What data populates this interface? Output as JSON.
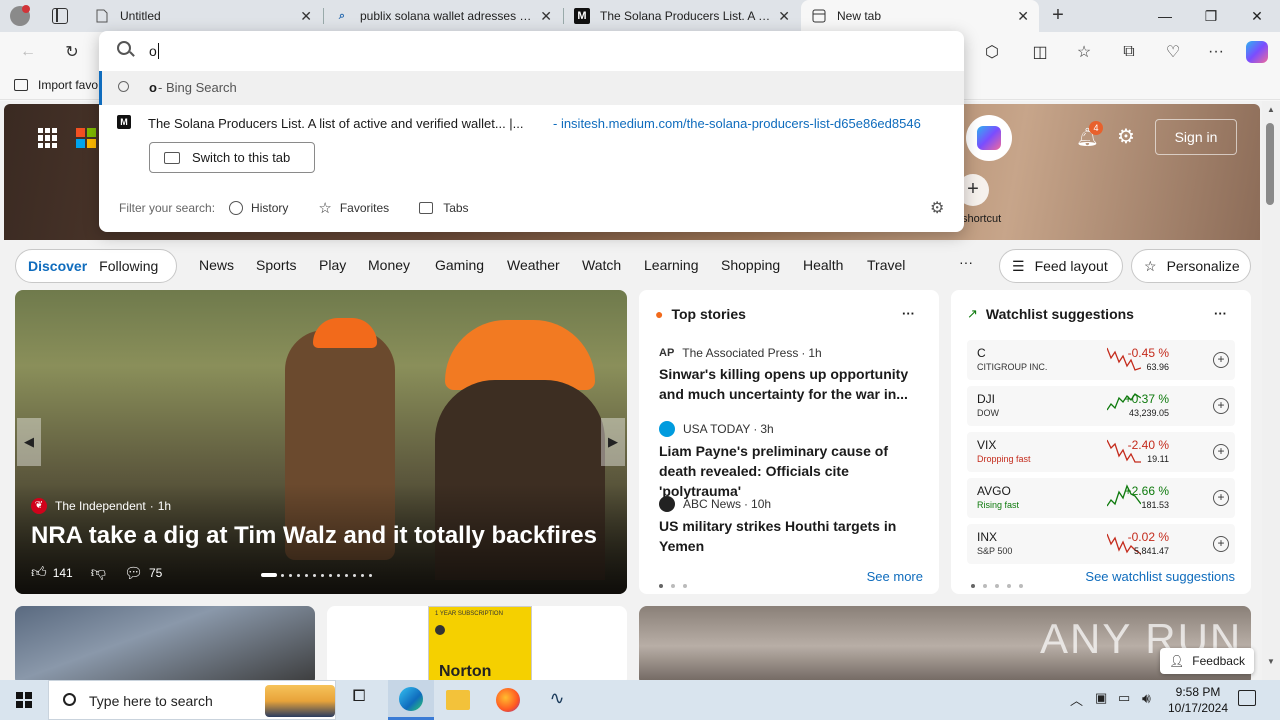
{
  "tabs": [
    {
      "title": "Untitled"
    },
    {
      "title": "publix solana wallet adresses - Se"
    },
    {
      "title": "The Solana Producers List. A list o"
    },
    {
      "title": "New tab"
    }
  ],
  "address": {
    "value": "o"
  },
  "favbar": {
    "import_label": "Import favo"
  },
  "suggestions": {
    "bing_query": "o",
    "bing_suffix": " - Bing Search",
    "result_title": "The Solana Producers List. A list of active and verified wallet... |...",
    "result_url": "- insitesh.medium.com/the-solana-producers-list-d65e86ed8546",
    "switch_tab": "Switch to this tab",
    "filter_label": "Filter your search:",
    "filters": [
      "History",
      "Favorites",
      "Tabs"
    ]
  },
  "header": {
    "notif_count": "4",
    "sign_in": "Sign in",
    "shortcut": "shortcut"
  },
  "nav": {
    "discover": "Discover",
    "following": "Following",
    "items": [
      "News",
      "Sports",
      "Play",
      "Money",
      "Gaming",
      "Weather",
      "Watch",
      "Learning",
      "Shopping",
      "Health",
      "Travel"
    ],
    "more": "···",
    "feed_layout": "Feed layout",
    "personalize": "Personalize"
  },
  "hero": {
    "source": "The Independent",
    "age": "1h",
    "headline": "NRA take a dig at Tim Walz and it totally backfires",
    "likes": "141",
    "comments": "75"
  },
  "top_stories": {
    "title": "Top stories",
    "more": "···",
    "items": [
      {
        "source": "The Associated Press",
        "age": "1h",
        "headline": "Sinwar's killing opens up opportunity and much uncertainty for the war in..."
      },
      {
        "source": "USA TODAY",
        "age": "3h",
        "headline": "Liam Payne's preliminary cause of death revealed: Officials cite 'polytrauma'"
      },
      {
        "source": "ABC News",
        "age": "10h",
        "headline": "US military strikes Houthi targets in Yemen"
      }
    ],
    "see_more": "See more"
  },
  "watchlist": {
    "title": "Watchlist suggestions",
    "more": "···",
    "stocks": [
      {
        "symbol": "C",
        "name": "CITIGROUP INC.",
        "change": "-0.45 %",
        "price": "63.96",
        "color": "#c42b1c"
      },
      {
        "symbol": "DJI",
        "name": "DOW",
        "change": "+0.37 %",
        "price": "43,239.05",
        "color": "#0e7a0d"
      },
      {
        "symbol": "VIX",
        "name": "Dropping fast",
        "change": "-2.40 %",
        "price": "19.11",
        "color": "#c42b1c"
      },
      {
        "symbol": "AVGO",
        "name": "Rising fast",
        "change": "+2.66 %",
        "price": "181.53",
        "color": "#0e7a0d"
      },
      {
        "symbol": "INX",
        "name": "S&P 500",
        "change": "-0.02 %",
        "price": "5,841.47",
        "color": "#c42b1c"
      }
    ],
    "see_all": "See watchlist suggestions"
  },
  "promo": {
    "brand": "Norton",
    "sub": "1 YEAR SUBSCRIPTION"
  },
  "watermark": "ANY RUN",
  "feedback": "Feedback",
  "taskbar": {
    "search_placeholder": "Type here to search",
    "time": "9:58 PM",
    "date": "10/17/2024"
  }
}
